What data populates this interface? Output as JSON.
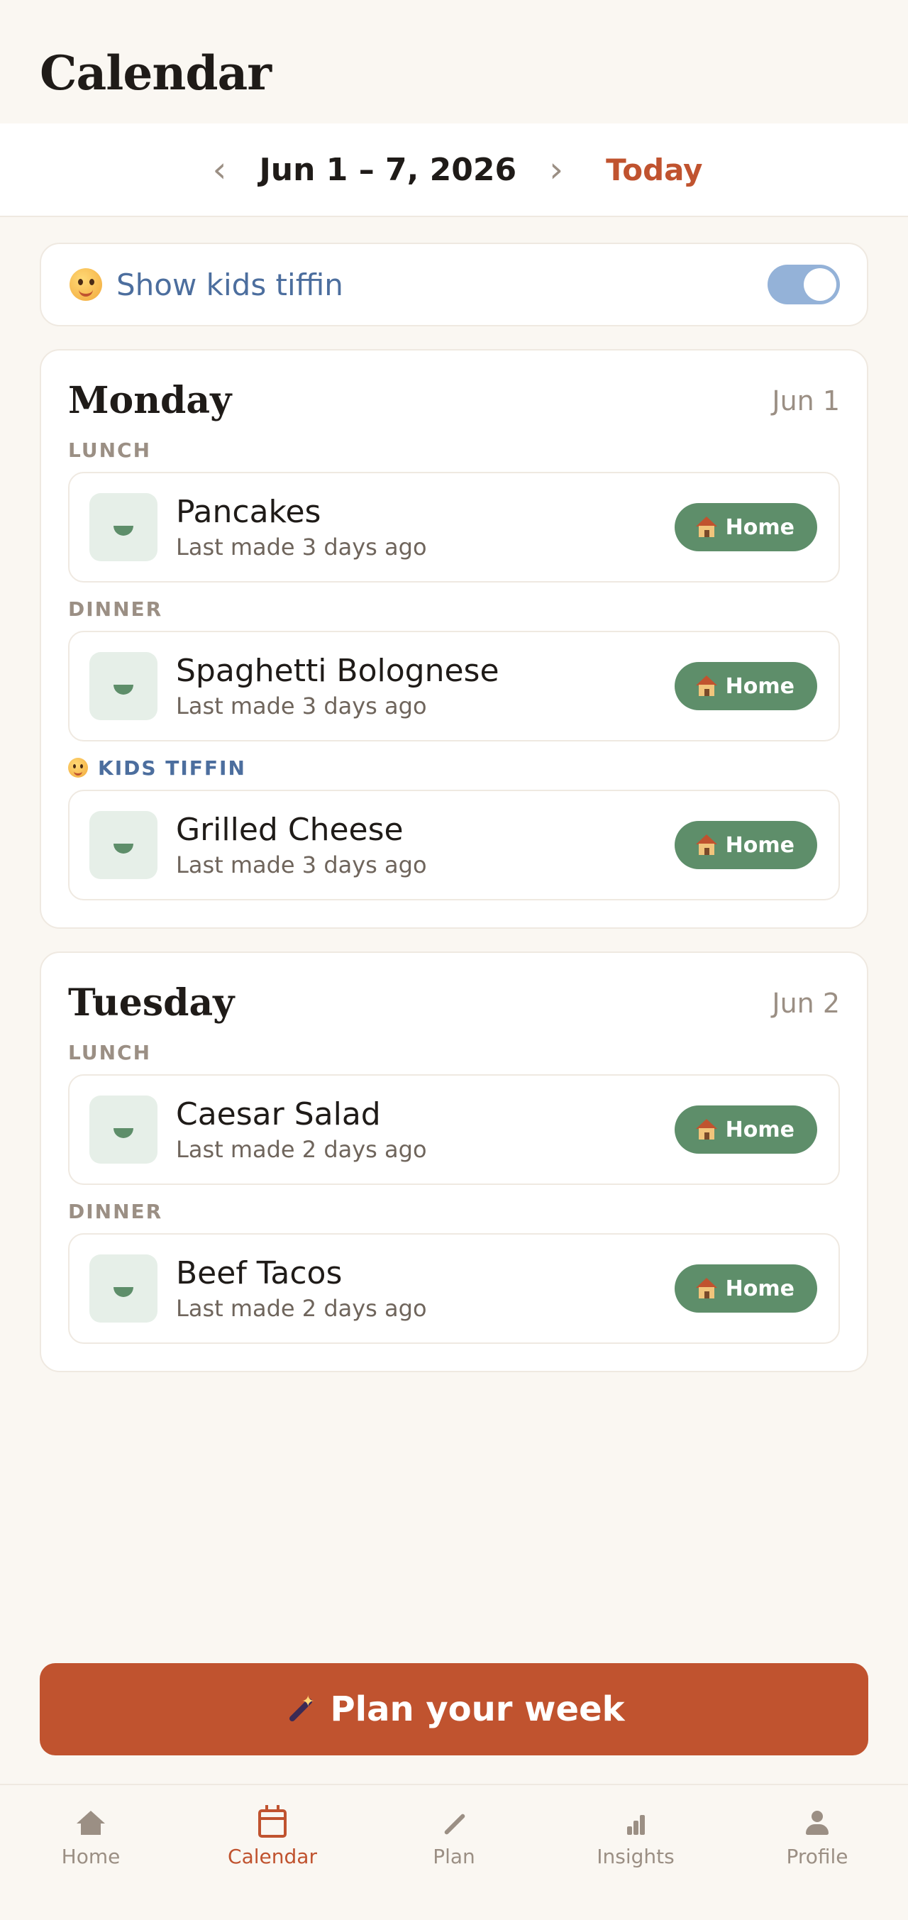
{
  "header": {
    "title": "Calendar"
  },
  "week_nav": {
    "prev_icon": "chevron-left-icon",
    "prev_glyph": "‹",
    "label": "Jun 1 – 7, 2026",
    "next_icon": "chevron-right-icon",
    "next_glyph": "›",
    "today_label": "Today"
  },
  "kids_toggle": {
    "label": "Show kids tiffin",
    "icon": "kid-face-icon",
    "enabled": true
  },
  "days": [
    {
      "name": "Monday",
      "date": "Jun 1",
      "slots": [
        {
          "label": "LUNCH",
          "meal": {
            "name": "Pancakes",
            "subtitle": "Last made 3 days ago",
            "badge": "Home"
          }
        },
        {
          "label": "DINNER",
          "meal": {
            "name": "Spaghetti Bolognese",
            "subtitle": "Last made 3 days ago",
            "badge": "Home"
          }
        },
        {
          "label": "KIDS TIFFIN",
          "meal": {
            "name": "Grilled Cheese",
            "subtitle": "Last made 3 days ago",
            "badge": "Home"
          }
        }
      ]
    },
    {
      "name": "Tuesday",
      "date": "Jun 2",
      "slots": [
        {
          "label": "LUNCH",
          "meal": {
            "name": "Caesar Salad",
            "subtitle": "Last made 2 days ago",
            "badge": "Home"
          }
        },
        {
          "label": "DINNER",
          "meal": {
            "name": "Beef Tacos",
            "subtitle": "Last made 2 days ago",
            "badge": "Home"
          }
        }
      ]
    }
  ],
  "cta": {
    "label": "Plan your week",
    "icon": "magic-wand-icon"
  },
  "tabbar": {
    "items": [
      {
        "label": "Home",
        "icon": "home-icon"
      },
      {
        "label": "Calendar",
        "icon": "calendar-icon"
      },
      {
        "label": "Plan",
        "icon": "wand-icon"
      },
      {
        "label": "Insights",
        "icon": "bar-chart-icon"
      },
      {
        "label": "Profile",
        "icon": "person-icon"
      }
    ],
    "active": "Calendar"
  },
  "colors": {
    "accent": "#c0532f",
    "badge_green": "#5e8e6a",
    "kids_blue": "#4c6e9e",
    "toggle_on": "#94b2d8",
    "background": "#faf7f2"
  }
}
